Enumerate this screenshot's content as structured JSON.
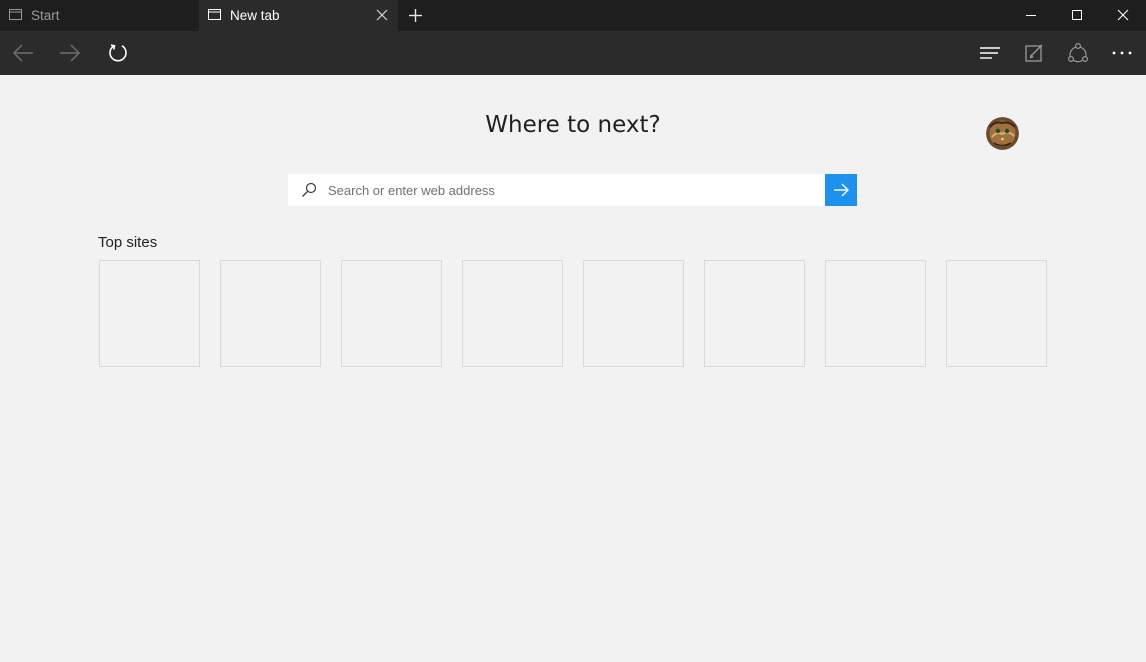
{
  "tabs": [
    {
      "label": "Start",
      "active": false
    },
    {
      "label": "New tab",
      "active": true
    }
  ],
  "icons": {
    "tab": "tab-page-icon",
    "close": "close-icon",
    "new_tab": "plus-icon",
    "minimize": "minimize-icon",
    "maximize": "maximize-icon",
    "window_close": "close-icon",
    "back": "arrow-left-icon",
    "forward": "arrow-right-icon",
    "refresh": "refresh-icon",
    "hub": "hub-icon",
    "web_note": "pen-note-icon",
    "share": "share-icon",
    "more": "more-dots-icon",
    "search": "search-icon",
    "go": "arrow-right-icon"
  },
  "main": {
    "headline": "Where to next?",
    "search": {
      "placeholder": "Search or enter web address",
      "value": ""
    },
    "top_sites_label": "Top sites",
    "top_sites_count": 8
  },
  "colors": {
    "titlebar": "#1e1e1e",
    "toolbar": "#2b2b2b",
    "page_bg": "#f2f2f2",
    "accent": "#1e90ee"
  }
}
